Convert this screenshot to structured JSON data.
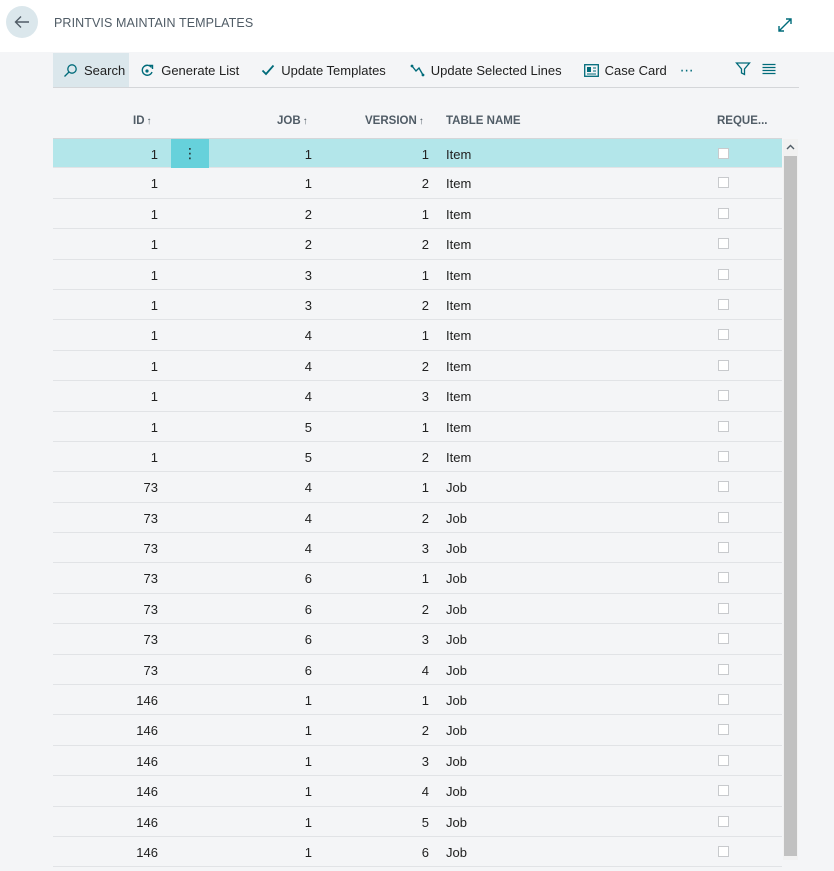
{
  "page": {
    "title": "PRINTVIS MAINTAIN TEMPLATES"
  },
  "toolbar": {
    "search": "Search",
    "generate": "Generate List",
    "update_templates": "Update Templates",
    "update_selected": "Update Selected Lines",
    "case_card": "Case Card",
    "more": "⋯"
  },
  "columns": {
    "id": "ID",
    "job": "JOB",
    "version": "VERSION",
    "table_name": "TABLE NAME",
    "requested": "REQUE...",
    "sort_arrow": "↑"
  },
  "row_menu": "⋮",
  "rows": [
    {
      "id": "1",
      "job": "1",
      "version": "1",
      "table": "Item"
    },
    {
      "id": "1",
      "job": "1",
      "version": "2",
      "table": "Item"
    },
    {
      "id": "1",
      "job": "2",
      "version": "1",
      "table": "Item"
    },
    {
      "id": "1",
      "job": "2",
      "version": "2",
      "table": "Item"
    },
    {
      "id": "1",
      "job": "3",
      "version": "1",
      "table": "Item"
    },
    {
      "id": "1",
      "job": "3",
      "version": "2",
      "table": "Item"
    },
    {
      "id": "1",
      "job": "4",
      "version": "1",
      "table": "Item"
    },
    {
      "id": "1",
      "job": "4",
      "version": "2",
      "table": "Item"
    },
    {
      "id": "1",
      "job": "4",
      "version": "3",
      "table": "Item"
    },
    {
      "id": "1",
      "job": "5",
      "version": "1",
      "table": "Item"
    },
    {
      "id": "1",
      "job": "5",
      "version": "2",
      "table": "Item"
    },
    {
      "id": "73",
      "job": "4",
      "version": "1",
      "table": "Job"
    },
    {
      "id": "73",
      "job": "4",
      "version": "2",
      "table": "Job"
    },
    {
      "id": "73",
      "job": "4",
      "version": "3",
      "table": "Job"
    },
    {
      "id": "73",
      "job": "6",
      "version": "1",
      "table": "Job"
    },
    {
      "id": "73",
      "job": "6",
      "version": "2",
      "table": "Job"
    },
    {
      "id": "73",
      "job": "6",
      "version": "3",
      "table": "Job"
    },
    {
      "id": "73",
      "job": "6",
      "version": "4",
      "table": "Job"
    },
    {
      "id": "146",
      "job": "1",
      "version": "1",
      "table": "Job"
    },
    {
      "id": "146",
      "job": "1",
      "version": "2",
      "table": "Job"
    },
    {
      "id": "146",
      "job": "1",
      "version": "3",
      "table": "Job"
    },
    {
      "id": "146",
      "job": "1",
      "version": "4",
      "table": "Job"
    },
    {
      "id": "146",
      "job": "1",
      "version": "5",
      "table": "Job"
    },
    {
      "id": "146",
      "job": "1",
      "version": "6",
      "table": "Job"
    }
  ],
  "icons": {
    "back": "arrow-left-icon",
    "expand": "expand-icon",
    "search": "search-icon",
    "generate": "generate-icon",
    "update": "checkmark-icon",
    "update_selected": "update-lines-icon",
    "case_card": "card-icon",
    "filter": "filter-icon",
    "list": "list-icon"
  },
  "colors": {
    "accent": "#006b7a",
    "selected_row": "#b3e6ea",
    "row_menu": "#66d1db"
  }
}
